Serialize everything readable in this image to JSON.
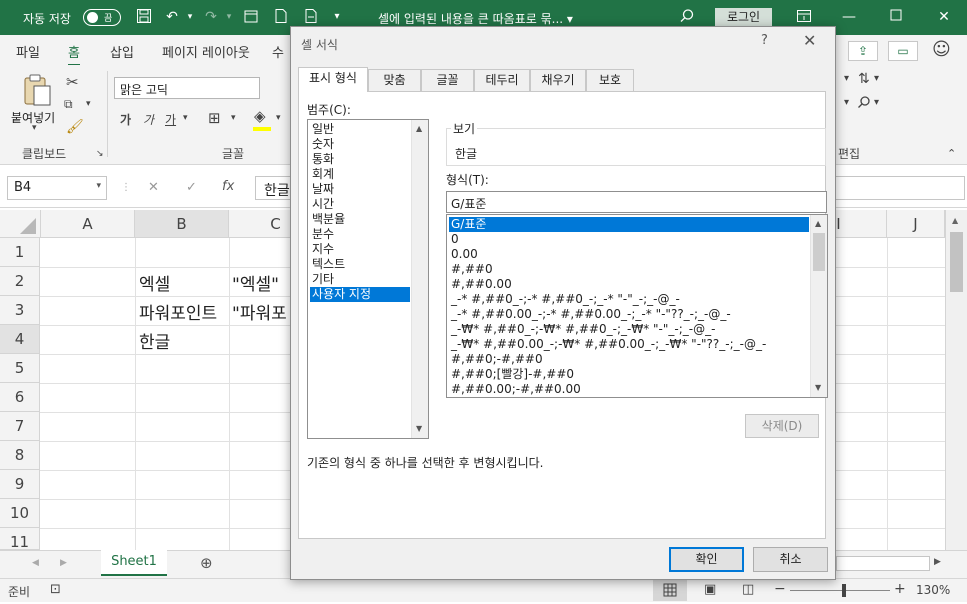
{
  "titlebar": {
    "autosave_label": "자동 저장",
    "autosave_state": "끔",
    "doc_title": "셀에 입력된 내용을 큰 따옴표로 묶... ▾",
    "login_label": "로그인",
    "colors": {
      "accent": "#217346"
    }
  },
  "ribbon_tabs": [
    "파일",
    "홈",
    "삽입",
    "페이지 레이아웃",
    "수"
  ],
  "ribbon": {
    "paste_label": "붙여넣기",
    "clipboard_group": "클립보드",
    "font_group": "글꼴",
    "edit_group": "편집",
    "font_name": "맑은 고딕",
    "bold": "가",
    "italic": "가",
    "underline": "가"
  },
  "formula_bar": {
    "name_box": "B4",
    "formula": "한글"
  },
  "grid": {
    "columns": [
      "A",
      "B",
      "C",
      "I",
      "J"
    ],
    "rows": [
      "1",
      "2",
      "3",
      "4",
      "5",
      "6",
      "7",
      "8",
      "9",
      "10",
      "11"
    ],
    "cells": {
      "B2": "엑셀",
      "C2": "\"엑셀\"",
      "B3": "파워포인트",
      "C3": "\"파워포",
      "B4": "한글"
    }
  },
  "sheet_tab": "Sheet1",
  "status": {
    "ready": "준비",
    "zoom": "130%"
  },
  "dialog": {
    "title": "셀 서식",
    "help": "?",
    "tabs": [
      "표시 형식",
      "맞춤",
      "글꼴",
      "테두리",
      "채우기",
      "보호"
    ],
    "category_label": "범주(C):",
    "categories": [
      "일반",
      "숫자",
      "통화",
      "회계",
      "날짜",
      "시간",
      "백분율",
      "분수",
      "지수",
      "텍스트",
      "기타",
      "사용자 지정"
    ],
    "selected_category": "사용자 지정",
    "preview_label": "보기",
    "preview_value": "한글",
    "format_label": "형식(T):",
    "format_value": "G/표준",
    "formats": [
      "G/표준",
      "0",
      "0.00",
      "#,##0",
      "#,##0.00",
      "_-* #,##0_-;-* #,##0_-;_-* \"-\"_-;_-@_-",
      "_-* #,##0.00_-;-* #,##0.00_-;_-* \"-\"??_-;_-@_-",
      "_-₩* #,##0_-;-₩* #,##0_-;_-₩* \"-\"_-;_-@_-",
      "_-₩* #,##0.00_-;-₩* #,##0.00_-;_-₩* \"-\"??_-;_-@_-",
      "#,##0;-#,##0",
      "#,##0;[빨강]-#,##0",
      "#,##0.00;-#,##0.00"
    ],
    "delete_label": "삭제(D)",
    "hint": "기존의 형식 중 하나를 선택한 후 변형시킵니다.",
    "ok_label": "확인",
    "cancel_label": "취소"
  }
}
